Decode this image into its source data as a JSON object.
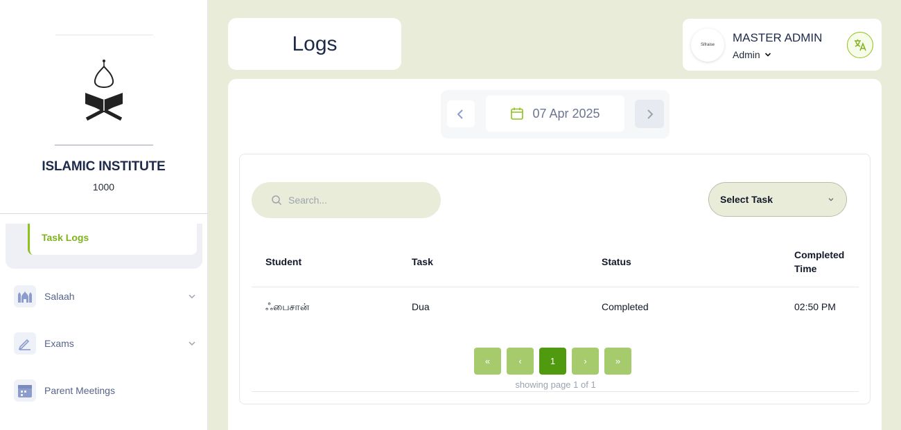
{
  "sidebar": {
    "institute_name": "ISLAMIC INSTITUTE",
    "institute_code": "1000",
    "active_sub_item": "Task Logs",
    "items": [
      {
        "label": "Salaah",
        "icon": "mosque-icon",
        "expandable": true
      },
      {
        "label": "Exams",
        "icon": "pencil-icon",
        "expandable": true
      },
      {
        "label": "Parent Meetings",
        "icon": "calendar-icon",
        "expandable": false
      }
    ]
  },
  "header": {
    "page_title": "Logs",
    "user_name": "MASTER ADMIN",
    "user_role": "Admin",
    "avatar_text": "Sifraise"
  },
  "date_nav": {
    "date": "07 Apr 2025"
  },
  "filters": {
    "search_placeholder": "Search...",
    "task_select": "Select Task"
  },
  "table": {
    "columns": [
      "Student",
      "Task",
      "Status",
      "Completed Time"
    ],
    "rows": [
      {
        "student": "ஃபைசான்",
        "task": "Dua",
        "status": "Completed",
        "completed_time": "02:50 PM"
      }
    ]
  },
  "pagination": {
    "first": "«",
    "prev": "‹",
    "current": "1",
    "next": "›",
    "last": "»",
    "summary": "showing page 1 of 1"
  },
  "colors": {
    "accent": "#8fc21a",
    "page_bg": "#e9ecd8",
    "pager_active": "#4f9a0f",
    "pager_inactive": "#a6cb6c"
  }
}
